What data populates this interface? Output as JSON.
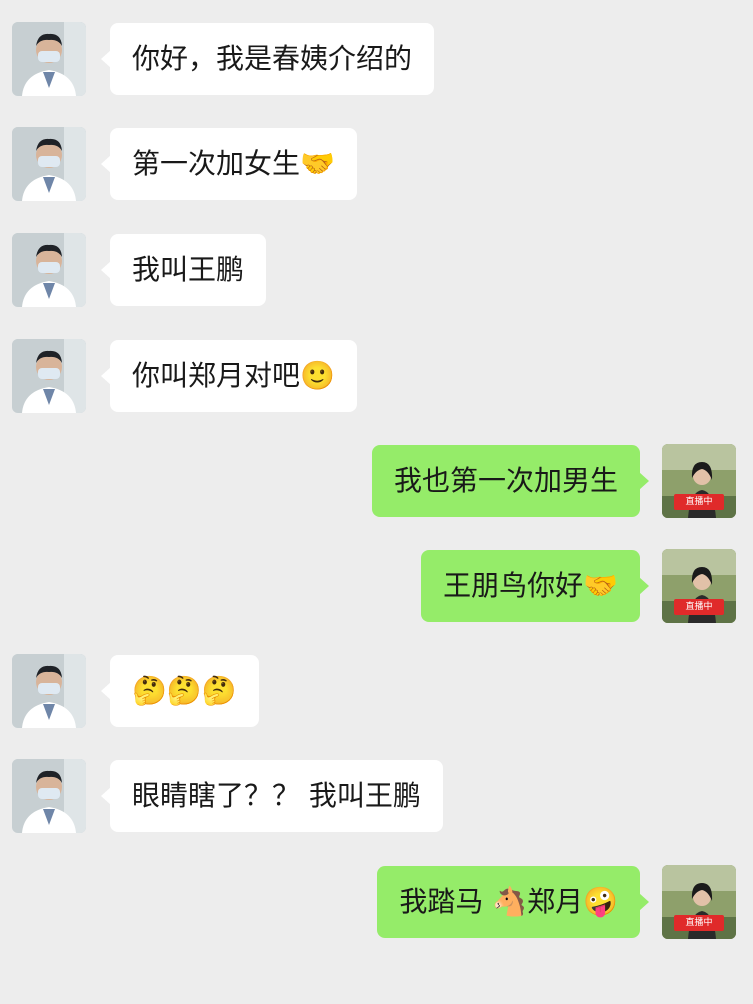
{
  "messages": [
    {
      "side": "in",
      "text": "你好，我是春姨介绍的"
    },
    {
      "side": "in",
      "text": "第一次加女生🤝"
    },
    {
      "side": "in",
      "text": "我叫王鹏"
    },
    {
      "side": "in",
      "text": "你叫郑月对吧🙂"
    },
    {
      "side": "out",
      "text": "我也第一次加男生"
    },
    {
      "side": "out",
      "text": "王朋鸟你好🤝"
    },
    {
      "side": "in",
      "text": "🤔🤔🤔"
    },
    {
      "side": "in",
      "text": "眼睛瞎了？？ 我叫王鹏"
    },
    {
      "side": "out",
      "text": "我踏马 🐴郑月🤪"
    }
  ],
  "avatars": {
    "doctor_icon": "doctor-avatar-icon",
    "girl_icon": "girl-avatar-icon",
    "live_badge": "直播中"
  },
  "colors": {
    "background": "#ededed",
    "incoming_bubble": "#ffffff",
    "outgoing_bubble": "#95ec69",
    "live_badge": "#e02a2a"
  }
}
